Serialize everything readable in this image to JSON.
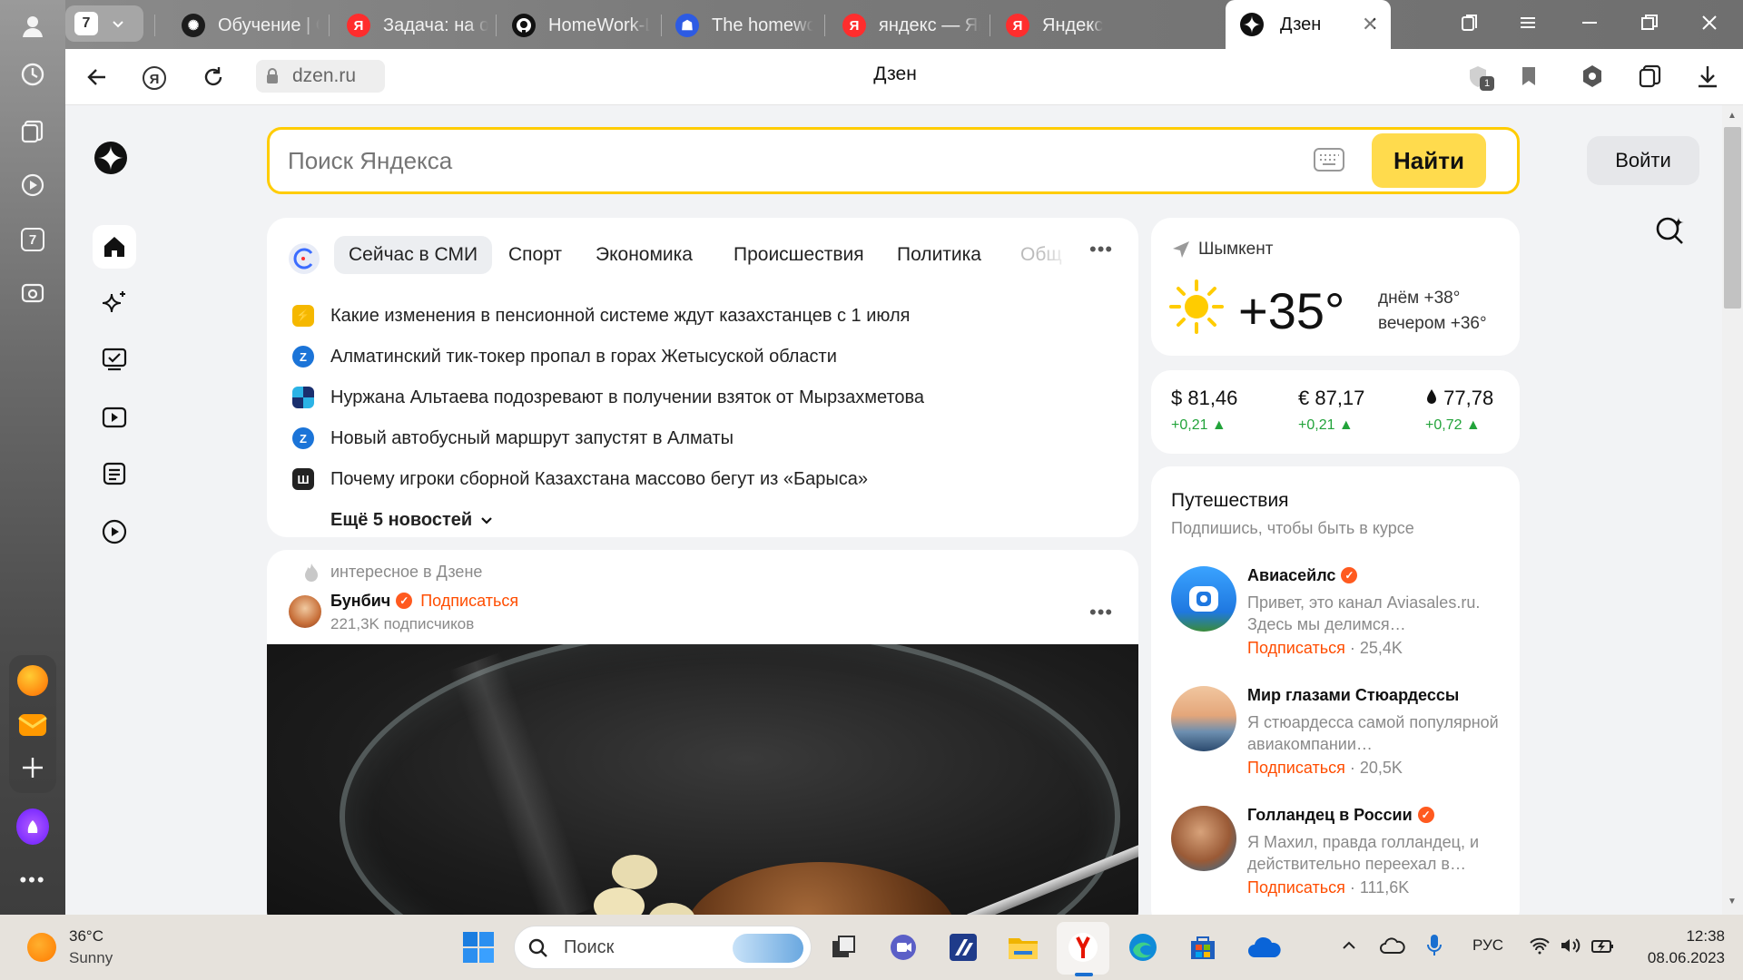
{
  "browser": {
    "tab_count": "7",
    "tabs": [
      {
        "title": "Обучение | C"
      },
      {
        "title": "Задача: на о"
      },
      {
        "title": "HomeWork-L"
      },
      {
        "title": "The homewo"
      },
      {
        "title": "яндекс — Ян"
      },
      {
        "title": "Яндекс"
      }
    ],
    "active_tab": {
      "title": "Дзен"
    },
    "address": "dzen.ru",
    "page_title": "Дзен",
    "tab_badge": "1",
    "side_badge": "7"
  },
  "search": {
    "placeholder": "Поиск Яндекса",
    "button": "Найти"
  },
  "login_button": "Войти",
  "news": {
    "categories": [
      "Сейчас в СМИ",
      "Спорт",
      "Экономика",
      "Происшествия",
      "Политика",
      "Общ"
    ],
    "items": [
      {
        "text": "Какие изменения в пенсионной системе ждут казахстанцев с 1 июля",
        "icon_color": "#f5b800"
      },
      {
        "text": "Алматинский тик-токер пропал в горах Жетысуской области",
        "icon_color": "#1b74d8"
      },
      {
        "text": "Нуржана Альтаева подозревают в получении взяток от Мырзахметова",
        "icon_color": "#1a2f6e"
      },
      {
        "text": "Новый автобусный маршрут запустят в Алматы",
        "icon_color": "#1b74d8"
      },
      {
        "text": "Почему игроки сборной Казахстана массово бегут из «Барыса»",
        "icon_color": "#222222"
      }
    ],
    "more": "Ещё 5 новостей"
  },
  "feed": {
    "label": "интересное в Дзене",
    "author": "Бунбич",
    "subscribe": "Подписаться",
    "subscribers": "221,3K подписчиков"
  },
  "weather": {
    "city": "Шымкент",
    "temp": "+35°",
    "day": "днём +38°",
    "evening": "вечером +36°"
  },
  "rates": [
    {
      "value": "$ 81,46",
      "delta": "+0,21 ▲"
    },
    {
      "value": "€ 87,17",
      "delta": "+0,21 ▲"
    },
    {
      "value": "77,78",
      "delta": "+0,72 ▲"
    }
  ],
  "travel": {
    "title": "Путешествия",
    "subtitle": "Подпишись, чтобы быть в курсе",
    "channels": [
      {
        "name": "Авиасейлс",
        "verified": true,
        "desc": "Привет, это канал Aviasales.ru. Здесь мы делимся…",
        "subscribe": "Подписаться",
        "count": "· 25,4K"
      },
      {
        "name": "Мир глазами Стюардессы",
        "verified": false,
        "desc": "Я стюардесса самой популярной авиакомпании…",
        "subscribe": "Подписаться",
        "count": "· 20,5K"
      },
      {
        "name": "Голландец в России",
        "verified": true,
        "desc": "Я Махил, правда голландец, и действительно переехал в…",
        "subscribe": "Подписаться",
        "count": "· 111,6K"
      }
    ]
  },
  "taskbar": {
    "weather_temp": "36°C",
    "weather_desc": "Sunny",
    "search_label": "Поиск",
    "lang": "РУС",
    "time": "12:38",
    "date": "08.06.2023"
  },
  "colors": {
    "accent_yellow": "#ffdb4d",
    "orange": "#ff4d00",
    "green": "#22a33a"
  }
}
